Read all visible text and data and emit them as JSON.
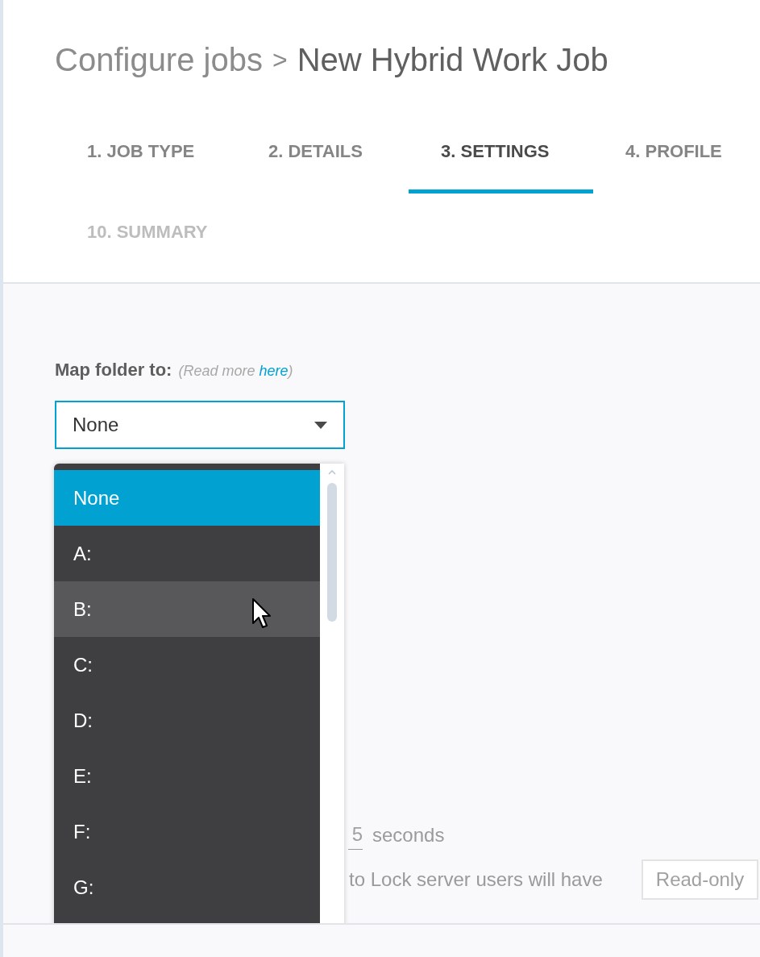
{
  "breadcrumb": {
    "parent": "Configure jobs",
    "separator": ">",
    "current": "New Hybrid Work Job"
  },
  "tabs": [
    {
      "label": "1. JOB TYPE",
      "selected": false,
      "disabled": false
    },
    {
      "label": "2. DETAILS",
      "selected": false,
      "disabled": false
    },
    {
      "label": "3. SETTINGS",
      "selected": true,
      "disabled": false
    },
    {
      "label": "4. PROFILE",
      "selected": false,
      "disabled": false
    },
    {
      "label": "10. SUMMARY",
      "selected": false,
      "disabled": true
    }
  ],
  "map_folder": {
    "label": "Map folder to:",
    "hint": {
      "before": "(Read more ",
      "link": "here",
      "after": ")"
    },
    "value": "None",
    "options": [
      {
        "label": "None",
        "selected": true,
        "hovered": false
      },
      {
        "label": "A:",
        "selected": false,
        "hovered": false
      },
      {
        "label": "B:",
        "selected": false,
        "hovered": true
      },
      {
        "label": "C:",
        "selected": false,
        "hovered": false
      },
      {
        "label": "D:",
        "selected": false,
        "hovered": false
      },
      {
        "label": "E:",
        "selected": false,
        "hovered": false
      },
      {
        "label": "F:",
        "selected": false,
        "hovered": false
      },
      {
        "label": "G:",
        "selected": false,
        "hovered": false
      }
    ]
  },
  "timeout": {
    "value": "5",
    "unit": "seconds"
  },
  "access": {
    "text": "to Lock server users will have",
    "value": "Read-only"
  }
}
